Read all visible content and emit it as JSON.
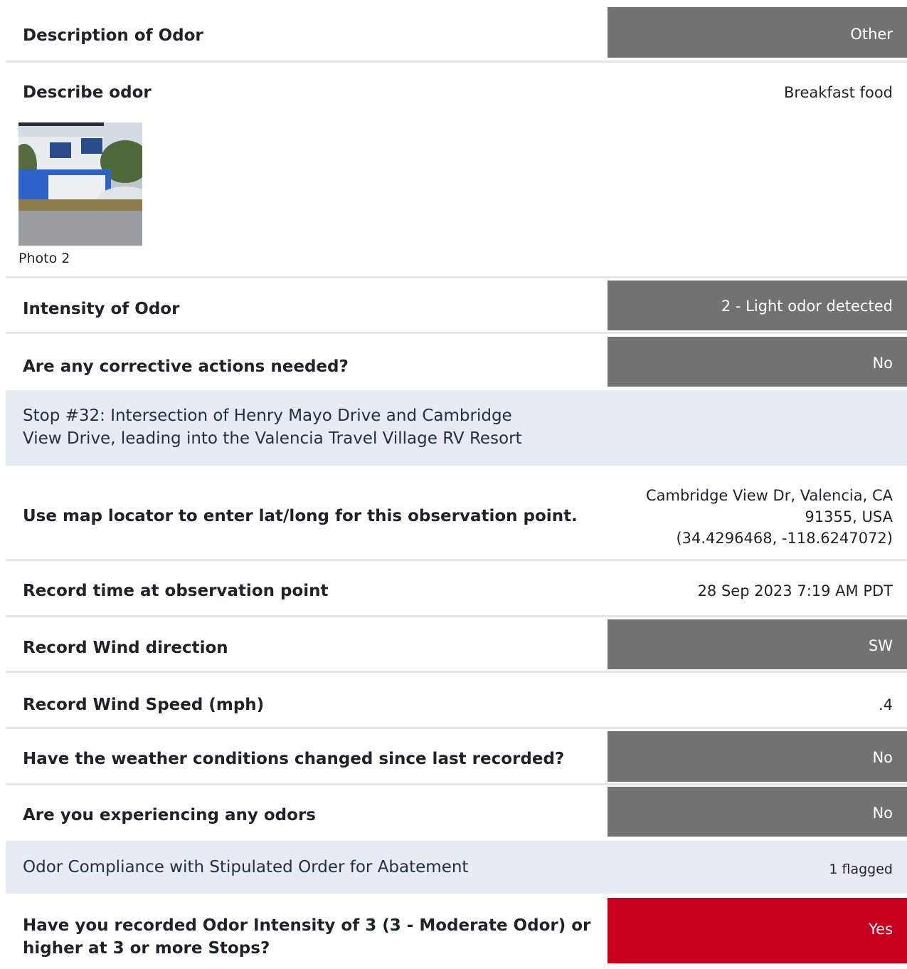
{
  "rows": {
    "description_of_odor": {
      "question": "Description of Odor",
      "answer": "Other"
    },
    "describe_odor": {
      "question": "Describe odor",
      "answer": "Breakfast food",
      "photo_caption": "Photo 2"
    },
    "intensity": {
      "question": "Intensity of Odor",
      "answer": "2 - Light odor detected"
    },
    "corrective": {
      "question": "Are any corrective actions needed?",
      "answer": "No"
    },
    "stop_section": {
      "line1": "Stop #32: Intersection of Henry Mayo Drive and Cambridge",
      "line2": "View Drive, leading into the Valencia Travel Village RV Resort"
    },
    "map_locator": {
      "question": "Use map locator to enter lat/long for this observation point.",
      "answer_line1": "Cambridge View Dr, Valencia, CA",
      "answer_line2": "91355, USA",
      "answer_line3": "(34.4296468, -118.6247072)"
    },
    "record_time": {
      "question": "Record time at observation point",
      "answer": "28 Sep 2023 7:19 AM PDT"
    },
    "wind_direction": {
      "question": "Record Wind direction",
      "answer": "SW"
    },
    "wind_speed": {
      "question": "Record Wind Speed (mph)",
      "answer": ".4"
    },
    "weather_changed": {
      "question": "Have the weather conditions changed since last recorded?",
      "answer": "No"
    },
    "experiencing_odors": {
      "question": "Are you experiencing any odors",
      "answer": "No"
    },
    "compliance_section": {
      "title": "Odor Compliance with Stipulated Order for Abatement",
      "flag": "1 flagged"
    },
    "intensity_3": {
      "question_line1": "Have you recorded Odor Intensity of 3 (3 - Moderate Odor) or",
      "question_line2": "higher at 3 or more Stops?",
      "answer": "Yes"
    }
  },
  "colors": {
    "answer_box": "#727272",
    "flagged_box": "#c8001e",
    "section_bg": "#e6ebf4",
    "divider": "#e2e4e8"
  }
}
